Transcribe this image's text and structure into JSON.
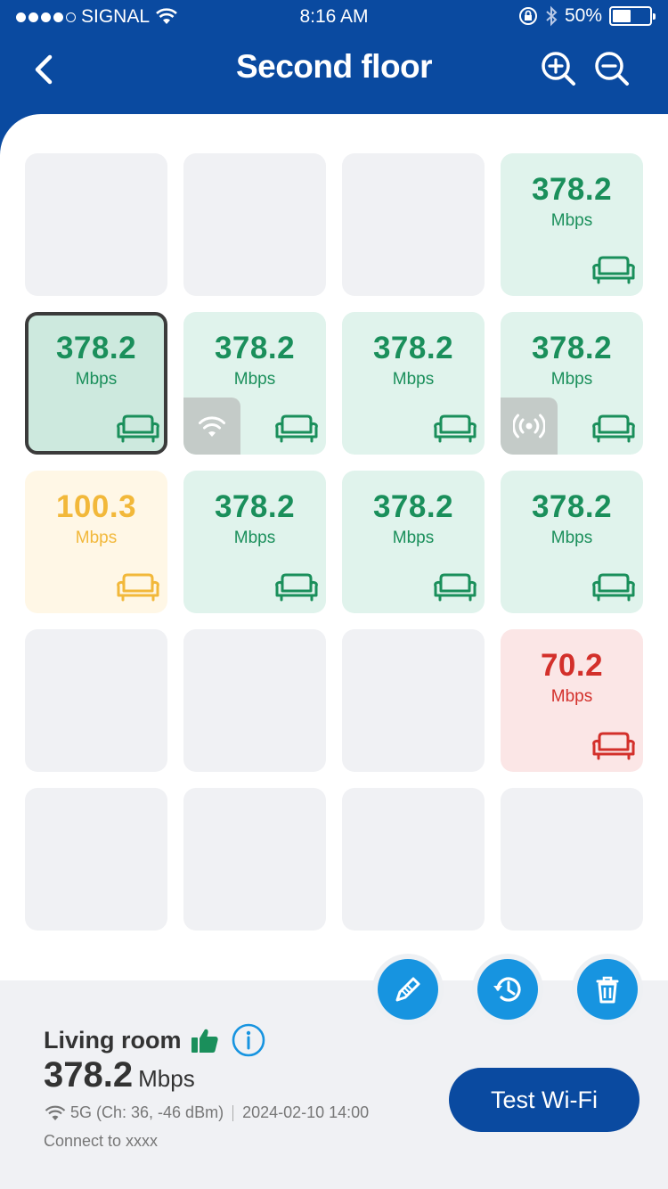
{
  "status_bar": {
    "carrier": "SIGNAL",
    "time": "8:16 AM",
    "battery": "50%",
    "battery_level": 0.5
  },
  "nav": {
    "title": "Second floor",
    "back_icon": "chevron-left-icon",
    "zoom_in_icon": "zoom-in-icon",
    "zoom_out_icon": "zoom-out-icon"
  },
  "grid": {
    "rows": [
      [
        {
          "state": "empty"
        },
        {
          "state": "empty"
        },
        {
          "state": "empty"
        },
        {
          "state": "green",
          "value": "378.2",
          "unit": "Mbps"
        }
      ],
      [
        {
          "state": "green",
          "value": "378.2",
          "unit": "Mbps",
          "selected": true
        },
        {
          "state": "green",
          "value": "378.2",
          "unit": "Mbps",
          "badge": "wifi-router-icon"
        },
        {
          "state": "green",
          "value": "378.2",
          "unit": "Mbps"
        },
        {
          "state": "green",
          "value": "378.2",
          "unit": "Mbps",
          "badge": "broadcast-node-icon"
        }
      ],
      [
        {
          "state": "yellow",
          "value": "100.3",
          "unit": "Mbps"
        },
        {
          "state": "green",
          "value": "378.2",
          "unit": "Mbps"
        },
        {
          "state": "green",
          "value": "378.2",
          "unit": "Mbps"
        },
        {
          "state": "green",
          "value": "378.2",
          "unit": "Mbps"
        }
      ],
      [
        {
          "state": "empty"
        },
        {
          "state": "empty"
        },
        {
          "state": "empty"
        },
        {
          "state": "red",
          "value": "70.2",
          "unit": "Mbps"
        }
      ],
      [
        {
          "state": "empty"
        },
        {
          "state": "empty"
        },
        {
          "state": "empty"
        },
        {
          "state": "empty"
        }
      ]
    ],
    "colors": {
      "green": "#1a8f5b",
      "yellow": "#f2b83a",
      "red": "#d3302b"
    }
  },
  "actions": {
    "edit_icon": "pencil-icon",
    "history_icon": "history-icon",
    "delete_icon": "trash-icon"
  },
  "detail": {
    "room": "Living room",
    "speed_value": "378.2",
    "speed_unit": "Mbps",
    "band": "5G (Ch: 36, -46 dBm)",
    "timestamp": "2024-02-10 14:00",
    "connect": "Connect to xxxx",
    "test_button": "Test Wi-Fi"
  },
  "colors": {
    "brand": "#0a4aa0",
    "accent": "#1794e0"
  }
}
